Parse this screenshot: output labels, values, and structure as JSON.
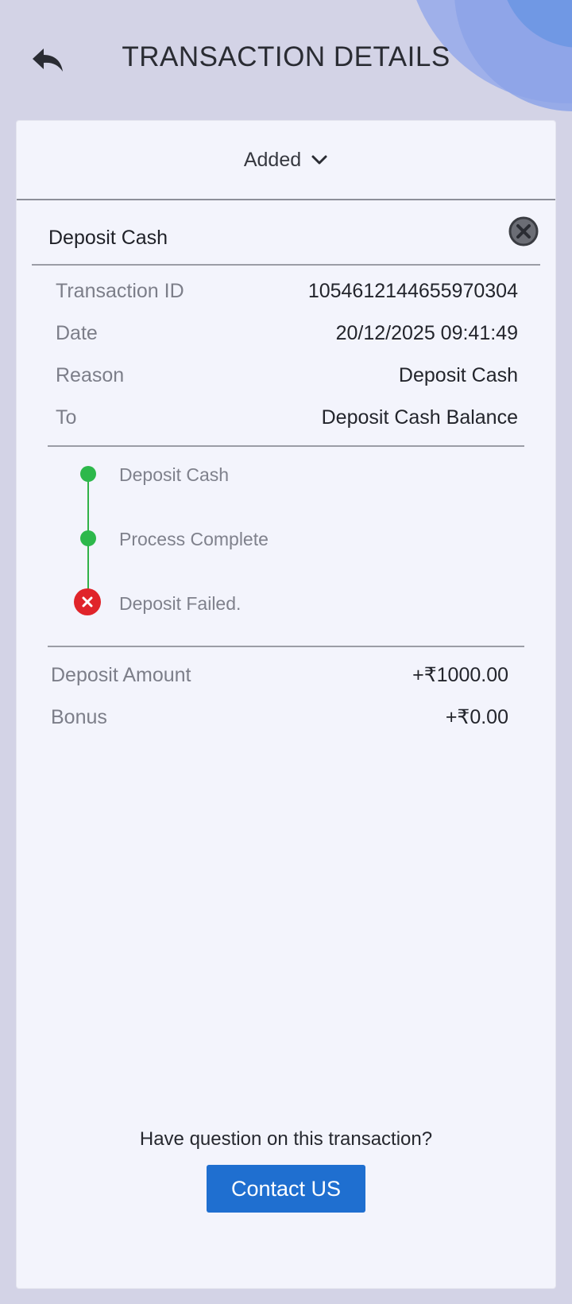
{
  "header": {
    "title": "TRANSACTION DETAILS",
    "back_icon": "reply-arrow-icon"
  },
  "status_selector": {
    "label": "Added",
    "icon": "chevron-down-icon"
  },
  "transaction": {
    "title": "Deposit Cash",
    "close_icon": "close-circle-icon",
    "details": [
      {
        "label": "Transaction ID",
        "value": "1054612144655970304"
      },
      {
        "label": "Date",
        "value": "20/12/2025 09:41:49"
      },
      {
        "label": "Reason",
        "value": "Deposit Cash"
      },
      {
        "label": "To",
        "value": "Deposit Cash Balance"
      }
    ],
    "timeline": [
      {
        "label": "Deposit Cash",
        "status": "done"
      },
      {
        "label": "Process Complete",
        "status": "done"
      },
      {
        "label": "Deposit Failed.",
        "status": "failed"
      }
    ],
    "amounts": [
      {
        "label": "Deposit Amount",
        "value": "+₹1000.00"
      },
      {
        "label": "Bonus",
        "value": "+₹0.00"
      }
    ]
  },
  "footer": {
    "question": "Have question on this transaction?",
    "contact_label": "Contact US"
  },
  "colors": {
    "accent": "#1f6fd0",
    "success": "#2db84b",
    "error": "#e0242a",
    "background": "#d3d3e6",
    "card": "#f3f4fc"
  }
}
